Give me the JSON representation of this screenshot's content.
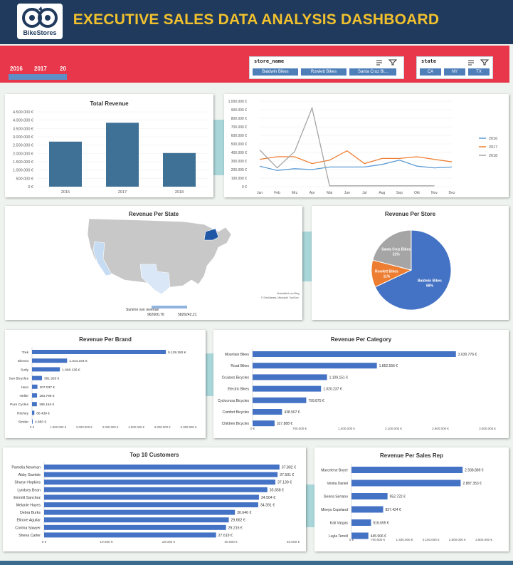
{
  "header": {
    "title": "EXECUTIVE SALES DATA ANALYSIS DASHBOARD",
    "logo_text": "BikeStores"
  },
  "filters": {
    "years": [
      "2016",
      "2017",
      "20"
    ],
    "store_slicer": {
      "header": "store_name",
      "items": [
        "Baldwin Bikes",
        "Rowlett Bikes",
        "Santa Cruz Bi..."
      ]
    },
    "state_slicer": {
      "header": "state",
      "items": [
        "CA",
        "NY",
        "TX"
      ]
    }
  },
  "legend_scale": {
    "title": "Summe von revenue",
    "min": "962600,76",
    "max": "5826242,21"
  },
  "map_credit": [
    "Unterstützt von Bing",
    "© GeoNames, Microsoft, TomTom"
  ],
  "chart_data": [
    {
      "id": "total_revenue",
      "type": "bar",
      "title": "Total Revenue",
      "categories": [
        "2016",
        "2017",
        "2018"
      ],
      "values": [
        2709484,
        3845515,
        2023989
      ],
      "ylim": [
        0,
        4500000
      ],
      "yticks": [
        "0 €",
        "500.000 €",
        "1.000.000 €",
        "1.500.000 €",
        "2.000.000 €",
        "2.500.000 €",
        "3.000.000 €",
        "3.500.000 €",
        "4.000.000 €",
        "4.500.000 €"
      ],
      "color": "#3f7196"
    },
    {
      "id": "monthly",
      "type": "line",
      "title": "",
      "categories": [
        "Jan",
        "Feb",
        "Mrz",
        "Apr",
        "Mai",
        "Jun",
        "Jul",
        "Aug",
        "Sep",
        "Okt",
        "Nov",
        "Dez"
      ],
      "ylim": [
        0,
        1000000
      ],
      "yticks": [
        "0 €",
        "100.000 €",
        "200.000 €",
        "300.000 €",
        "400.000 €",
        "500.000 €",
        "600.000 €",
        "700.000 €",
        "800.000 €",
        "900.000 €",
        "1.000.000 €"
      ],
      "legend_position": "right",
      "series": [
        {
          "name": "2016",
          "color": "#5b9bd5",
          "values": [
            240000,
            190000,
            210000,
            200000,
            230000,
            230000,
            230000,
            260000,
            310000,
            240000,
            220000,
            230000
          ]
        },
        {
          "name": "2017",
          "color": "#ed7d31",
          "values": [
            320000,
            350000,
            350000,
            270000,
            310000,
            420000,
            270000,
            330000,
            330000,
            350000,
            320000,
            290000
          ]
        },
        {
          "name": "2018",
          "color": "#a5a5a5",
          "values": [
            430000,
            220000,
            410000,
            920000,
            10000,
            10000,
            10000,
            10000,
            10000,
            10000,
            10000,
            null
          ]
        }
      ]
    },
    {
      "id": "store",
      "type": "pie",
      "title": "Revenue Per Store",
      "slices": [
        {
          "label": "Baldwin Bikes",
          "pct": "68%",
          "value": 68,
          "color": "#4472c4"
        },
        {
          "label": "Rowlett Bikes",
          "pct": "11%",
          "value": 11,
          "color": "#ed7d31"
        },
        {
          "label": "Santa Cruz Bikes",
          "pct": "21%",
          "value": 21,
          "color": "#a5a5a5"
        }
      ]
    },
    {
      "id": "brand",
      "type": "bar",
      "orientation": "horizontal",
      "title": "Revenue Per Brand",
      "categories": [
        "Trek",
        "Electra",
        "Surly",
        "Sun Bicycles",
        "Haro",
        "Heller",
        "Pure Cycles",
        "Ritchey",
        "Strider"
      ],
      "values": [
        5129382,
        1344344,
        1068136,
        381920,
        207037,
        193799,
        186164,
        88439,
        4850
      ],
      "labels": [
        "5.129.382 €",
        "1.344.344 €",
        "1.068.136 €",
        "381.920 €",
        "207.037 €",
        "193.799 €",
        "186.164 €",
        "88.439 €",
        "4.850 €"
      ],
      "xlim": [
        0,
        6000000
      ],
      "xticks": [
        "0 €",
        "1.000.000 €",
        "2.000.000 €",
        "3.000.000 €",
        "4.000.000 €",
        "5.000.000 €",
        "6.000.000 €"
      ],
      "color": "#4472c4"
    },
    {
      "id": "category",
      "type": "bar",
      "orientation": "horizontal",
      "title": "Revenue Per Category",
      "categories": [
        "Mountain Bikes",
        "Road Bikes",
        "Cruisers Bicycles",
        "Electric Bikes",
        "Cyclocross Bicycles",
        "Comfort Bicycles",
        "Children Bicycles"
      ],
      "values": [
        3030776,
        1852556,
        1109151,
        1020237,
        799875,
        438507,
        327888
      ],
      "labels": [
        "3.030.776 €",
        "1.852.556 €",
        "1.109.151 €",
        "1.020.237 €",
        "799.875 €",
        "438.507 €",
        "327.888 €"
      ],
      "xlim": [
        0,
        3500000
      ],
      "xticks": [
        "0 €",
        "700.000 €",
        "1.400.000 €",
        "2.100.000 €",
        "2.800.000 €",
        "3.500.000 €"
      ],
      "color": "#4472c4"
    },
    {
      "id": "customers",
      "type": "bar",
      "orientation": "horizontal",
      "title": "Top 10 Customers",
      "categories": [
        "Pamelia Newman",
        "Abby Gamble",
        "Sharyn Hopkins",
        "Lyndsey Bean",
        "Emmitt Sanchez",
        "Melanie Hayes",
        "Debra Burks",
        "Elinore Aguilar",
        "Corrina Sawyer",
        "Shena Carter"
      ],
      "values": [
        37802,
        37501,
        37139,
        35858,
        34504,
        34391,
        30646,
        29662,
        29215,
        27619
      ],
      "labels": [
        "37.802 €",
        "37.501 €",
        "37.139 €",
        "35.858 €",
        "34.504 €",
        "34.391 €",
        "30.646 €",
        "29.662 €",
        "29.215 €",
        "27.619 €"
      ],
      "xlim": [
        0,
        40000
      ],
      "xticks": [
        "0 €",
        "10.000 €",
        "20.000 €",
        "30.000 €",
        "40.000 €"
      ],
      "color": "#4472c4"
    },
    {
      "id": "salesrep",
      "type": "bar",
      "orientation": "horizontal",
      "title": "Revenue Per Sales Rep",
      "categories": [
        "Marcelene Boyer",
        "Venita Daniel",
        "Genna Serrano",
        "Mireya Copeland",
        "Kali Vargas",
        "Layla Terrell"
      ],
      "values": [
        2938889,
        2887353,
        952722,
        837424,
        516655,
        445906
      ],
      "labels": [
        "2.938.889 €",
        "2.887.353 €",
        "952.722 €",
        "837.424 €",
        "516.655 €",
        "445.906 €"
      ],
      "xlim": [
        0,
        3500000
      ],
      "xticks": [
        "0 €",
        "700.000 €",
        "1.400.000 €",
        "2.100.000 €",
        "2.800.000 €",
        "3.500.000 €"
      ],
      "color": "#4472c4"
    }
  ]
}
